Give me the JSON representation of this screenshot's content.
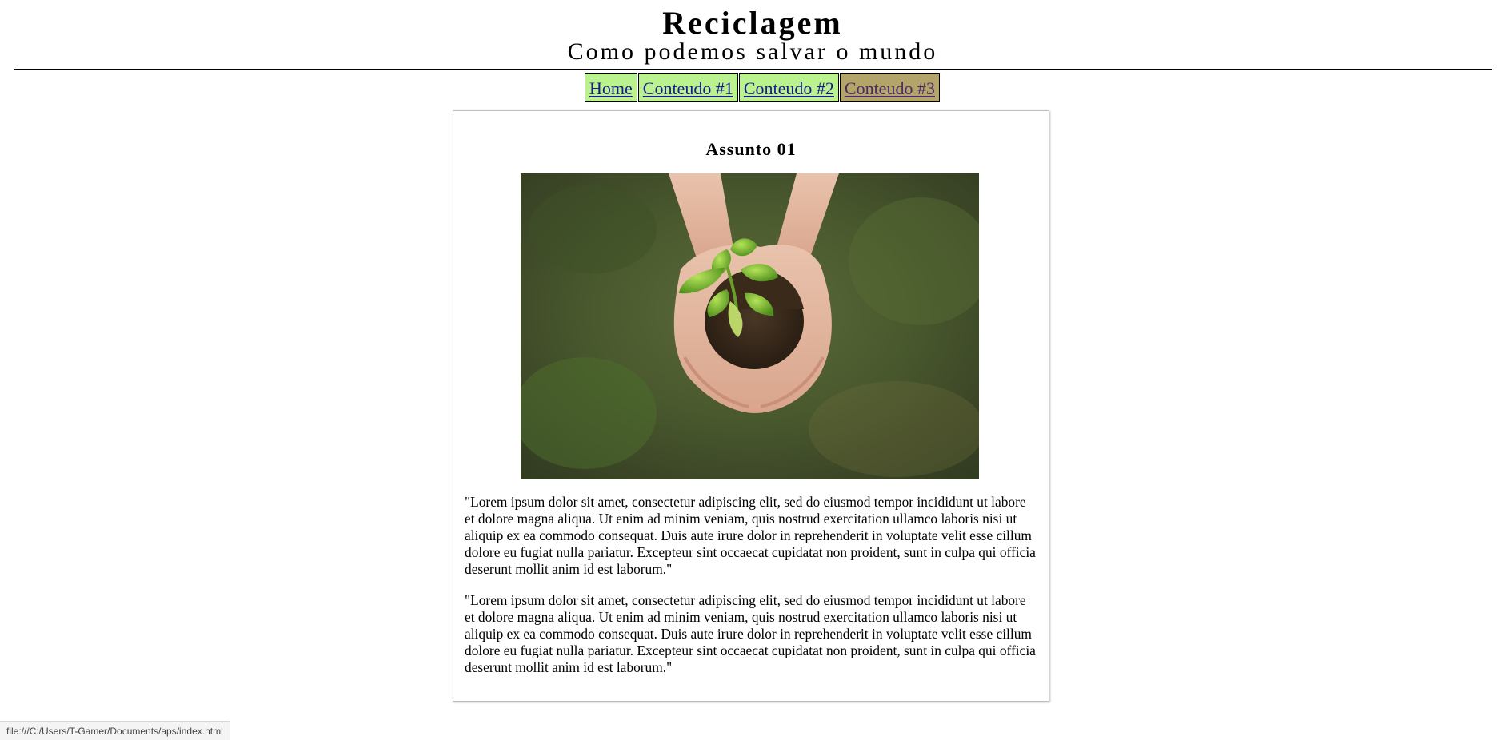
{
  "header": {
    "title": "Reciclagem",
    "subtitle": "Como podemos salvar o mundo"
  },
  "nav": {
    "items": [
      {
        "label": "Home "
      },
      {
        "label": "Conteudo #1 "
      },
      {
        "label": "Conteudo #2 "
      },
      {
        "label": "Conteudo #3"
      }
    ]
  },
  "article": {
    "title": "Assunto 01",
    "image": "hands-holding-seedling-in-soil",
    "paragraphs": [
      "\"Lorem ipsum dolor sit amet, consectetur adipiscing elit, sed do eiusmod tempor incididunt ut labore et dolore magna aliqua. Ut enim ad minim veniam, quis nostrud exercitation ullamco laboris nisi ut aliquip ex ea commodo consequat. Duis aute irure dolor in reprehenderit in voluptate velit esse cillum dolore eu fugiat nulla pariatur. Excepteur sint occaecat cupidatat non proident, sunt in culpa qui officia deserunt mollit anim id est laborum.\"",
      "\"Lorem ipsum dolor sit amet, consectetur adipiscing elit, sed do eiusmod tempor incididunt ut labore et dolore magna aliqua. Ut enim ad minim veniam, quis nostrud exercitation ullamco laboris nisi ut aliquip ex ea commodo consequat. Duis aute irure dolor in reprehenderit in voluptate velit esse cillum dolore eu fugiat nulla pariatur. Excepteur sint occaecat cupidatat non proident, sunt in culpa qui officia deserunt mollit anim id est laborum.\""
    ]
  },
  "status_bar": {
    "url": "file:///C:/Users/T-Gamer/Documents/aps/index.html"
  },
  "colors": {
    "nav_background": "#b9f28f",
    "nav_active_background": "#b3a46a",
    "link": "#1a1a8c",
    "visited_link": "#4b2a6b"
  }
}
